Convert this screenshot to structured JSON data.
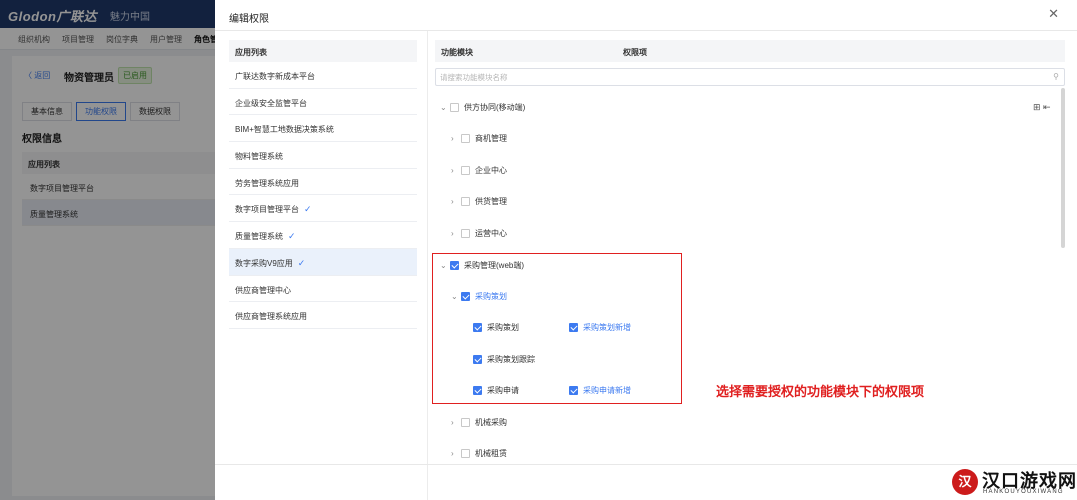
{
  "background_app": {
    "logo": "Glodon广联达",
    "slogan": "魅力中国",
    "nav": [
      "组织机构",
      "项目管理",
      "岗位字典",
      "用户管理",
      "角色管"
    ],
    "back": "〈 返回",
    "role_name": "物资管理员",
    "role_status": "已启用",
    "tabs": [
      "基本信息",
      "功能权限",
      "数据权限"
    ],
    "section_title": "权限信息",
    "table_header": "应用列表",
    "rows": [
      "数字项目管理平台",
      "质量管理系统"
    ]
  },
  "drawer": {
    "title": "编辑权限",
    "close_icon": "close-icon",
    "app_list_header": "应用列表",
    "apps": [
      {
        "name": "广联达数字新成本平台",
        "checked": false
      },
      {
        "name": "企业级安全监管平台",
        "checked": false
      },
      {
        "name": "BIM+智慧工地数据决策系统",
        "checked": false
      },
      {
        "name": "物料管理系统",
        "checked": false
      },
      {
        "name": "劳务管理系统应用",
        "checked": false
      },
      {
        "name": "数字项目管理平台",
        "checked": true
      },
      {
        "name": "质量管理系统",
        "checked": true
      },
      {
        "name": "数字采购V9应用",
        "checked": true
      },
      {
        "name": "供应商管理中心",
        "checked": false
      },
      {
        "name": "供应商管理系统应用",
        "checked": false
      }
    ],
    "check_glyph": "✓",
    "module_header": "功能模块",
    "permission_header": "权限项",
    "search_placeholder": "请搜索功能模块名称",
    "tree": {
      "root": "供方协同(移动端)",
      "children": [
        "商机管理",
        "企业中心",
        "供货管理",
        "运营中心"
      ],
      "web_root": "采购管理(web端)",
      "plan": "采购策划",
      "plan_item": "采购策划",
      "plan_perm": "采购策划新增",
      "plan_review": "采购策划跟踪",
      "apply": "采购申请",
      "apply_perm": "采购申请新增",
      "after": [
        "机械采购",
        "机械租赁"
      ]
    }
  },
  "annotation": "选择需要授权的功能模块下的权限项",
  "watermark": {
    "logo_glyph": "汉",
    "text": "汉口游戏网",
    "sub": "HANKOUYOUXIWANG"
  },
  "colors": {
    "accent": "#3c7af0",
    "highlight": "#e02020",
    "topbar": "#1f3a6b"
  }
}
